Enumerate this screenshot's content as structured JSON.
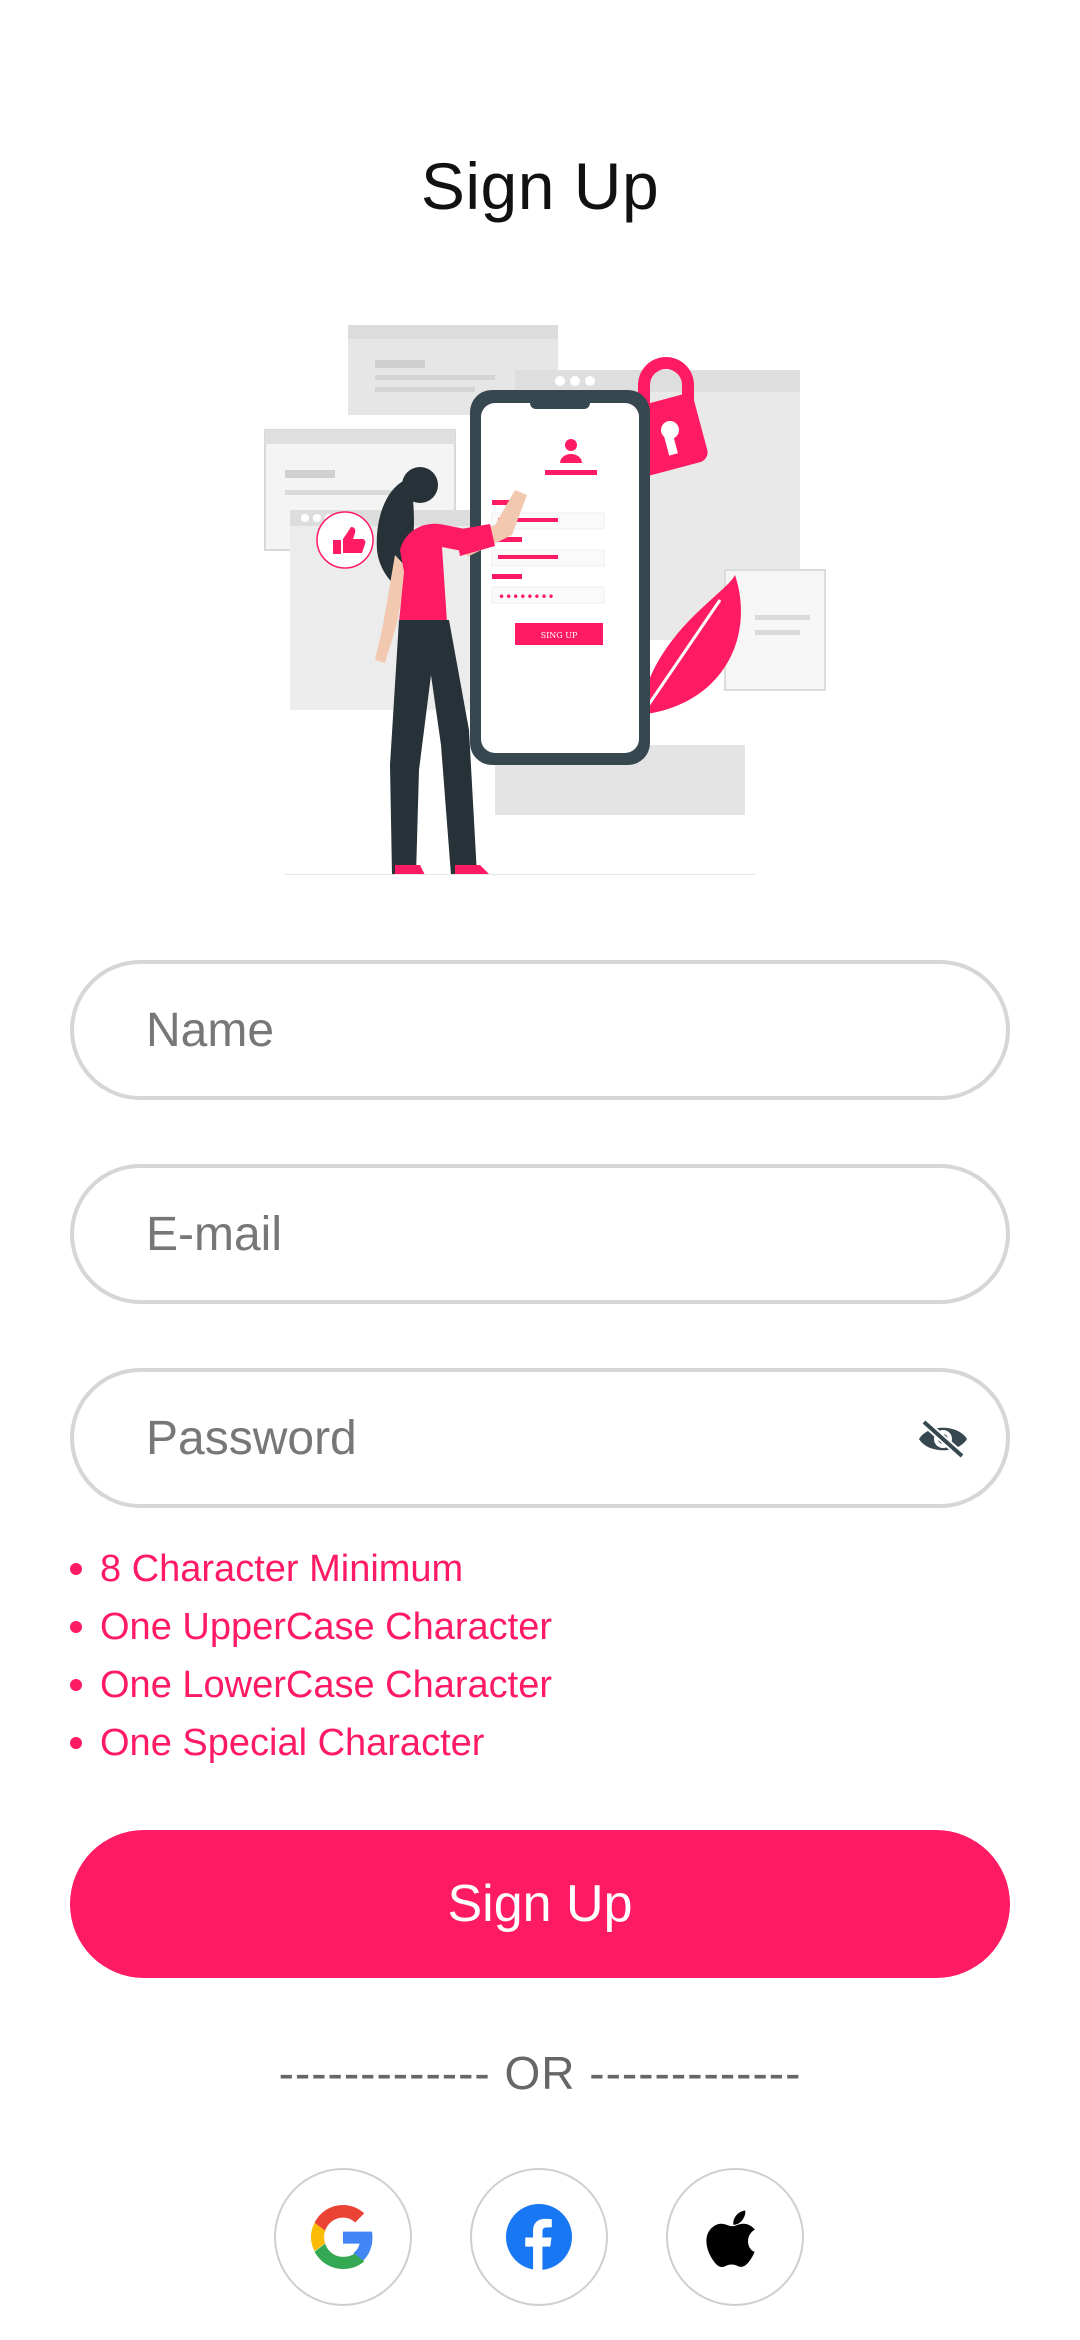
{
  "header": {
    "title": "Sign Up"
  },
  "illustration": {
    "button_text": "SING UP",
    "password_dots": "••••••••",
    "icon": "signup-illustration"
  },
  "form": {
    "name_placeholder": "Name",
    "email_placeholder": "E-mail",
    "password_placeholder": "Password",
    "password_toggle_icon": "eye-off-icon"
  },
  "password_rules": [
    "8 Character Minimum",
    "One UpperCase Character",
    "One LowerCase Character",
    "One Special Character"
  ],
  "signup_button": "Sign Up",
  "divider": "------------- OR -------------",
  "social": [
    {
      "icon": "google-icon"
    },
    {
      "icon": "facebook-icon"
    },
    {
      "icon": "apple-icon"
    }
  ],
  "colors": {
    "accent": "#ff1a64",
    "border": "#d6d6d6",
    "text_muted": "#777777",
    "facebook": "#1877f2"
  }
}
